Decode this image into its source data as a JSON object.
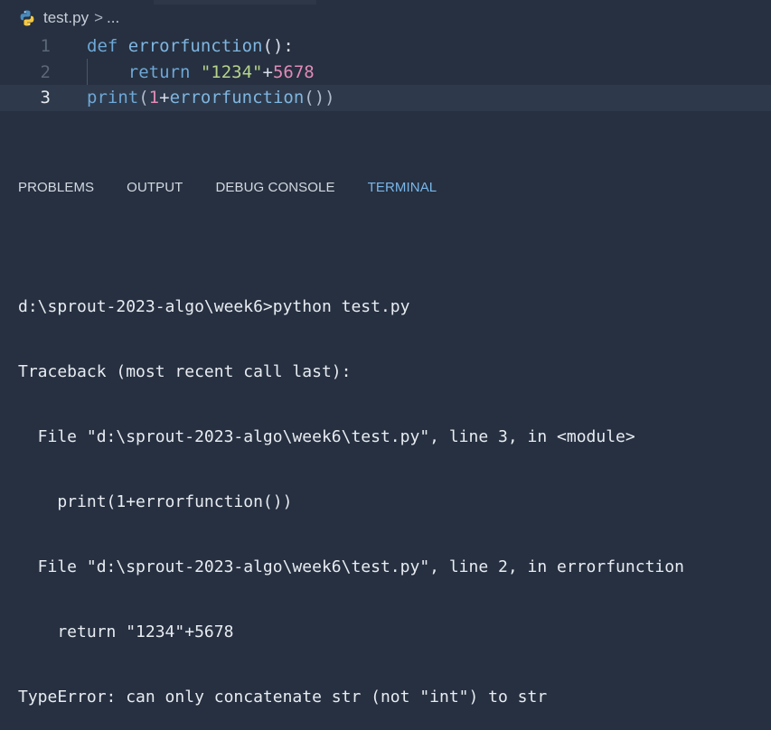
{
  "breadcrumb": {
    "file": "test.py",
    "sep": ">",
    "more": "..."
  },
  "editor": {
    "lines": [
      {
        "number": "1",
        "tokens": [
          "def",
          " ",
          "errorfunction",
          "():"
        ]
      },
      {
        "number": "2",
        "tokens": [
          "    return ",
          "\"1234\"",
          "+",
          "5678"
        ]
      },
      {
        "number": "3",
        "tokens": [
          "print",
          "(",
          "1",
          "+",
          "errorfunction",
          "())"
        ]
      }
    ]
  },
  "panel": {
    "tabs": [
      "PROBLEMS",
      "OUTPUT",
      "DEBUG CONSOLE",
      "TERMINAL"
    ],
    "active_tab": "TERMINAL"
  },
  "terminal": {
    "lines": [
      "d:\\sprout-2023-algo\\week6>python test.py",
      "Traceback (most recent call last):",
      "  File \"d:\\sprout-2023-algo\\week6\\test.py\", line 3, in <module>",
      "    print(1+errorfunction())",
      "  File \"d:\\sprout-2023-algo\\week6\\test.py\", line 2, in errorfunction",
      "    return \"1234\"+5678",
      "TypeError: can only concatenate str (not \"int\") to str"
    ]
  },
  "colors": {
    "background": "#263040",
    "keyword": "#6ea7d6",
    "string": "#b7d38b",
    "number": "#e08bb6",
    "active_tab": "#79b6ea"
  }
}
